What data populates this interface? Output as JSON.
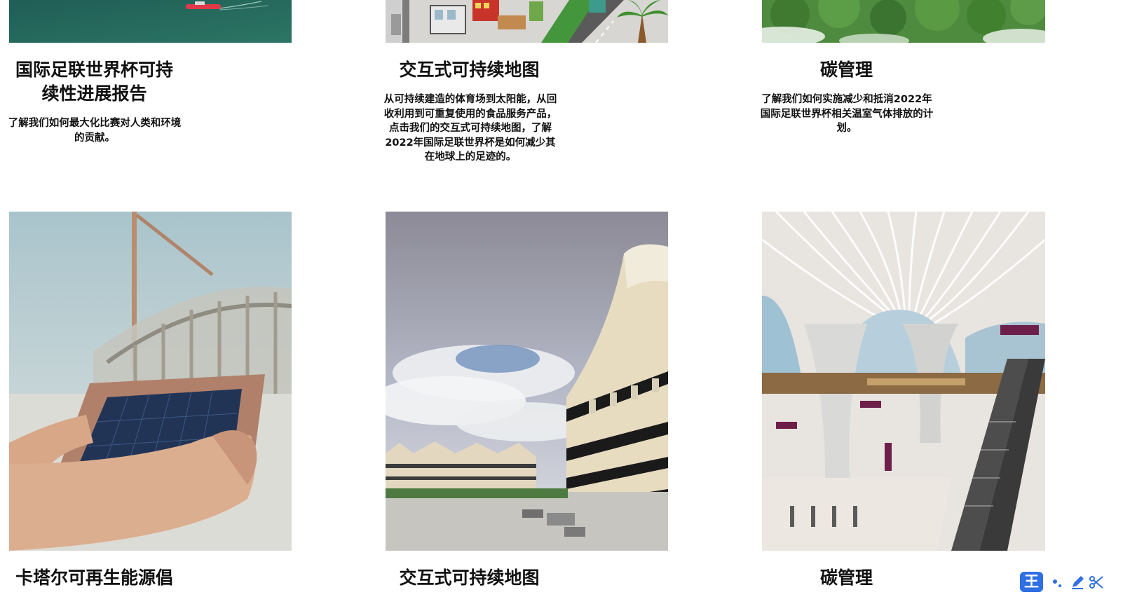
{
  "cards": [
    {
      "title": "国际足联世界杯可持续性进展报告",
      "desc": "了解我们如何最大化比赛对人类和环境的贡献。",
      "image": "ocean-ship-photo"
    },
    {
      "title": "交互式可持续地图",
      "desc": "从可持续建造的体育场到太阳能，从回收利用到可重复使用的食品服务产品，点击我们的交互式可持续地图，了解2022年国际足联世界杯是如何减少其在地球上的足迹的。",
      "image": "city-illustration"
    },
    {
      "title": "碳管理",
      "desc": "了解我们如何实施减少和抵消2022年国际足联世界杯相关温室气体排放的计划。",
      "image": "forest-aerial-photo"
    },
    {
      "title": "卡塔尔可再生能源倡",
      "image": "solar-panel-photo"
    },
    {
      "title": "交互式可持续地图",
      "image": "stadium-photo"
    },
    {
      "title": "碳管理",
      "image": "metro-station-photo"
    }
  ],
  "toolbar": {
    "ime_label": "王",
    "icons": [
      "punctuation-icon",
      "pen-icon",
      "scissors-icon"
    ]
  }
}
